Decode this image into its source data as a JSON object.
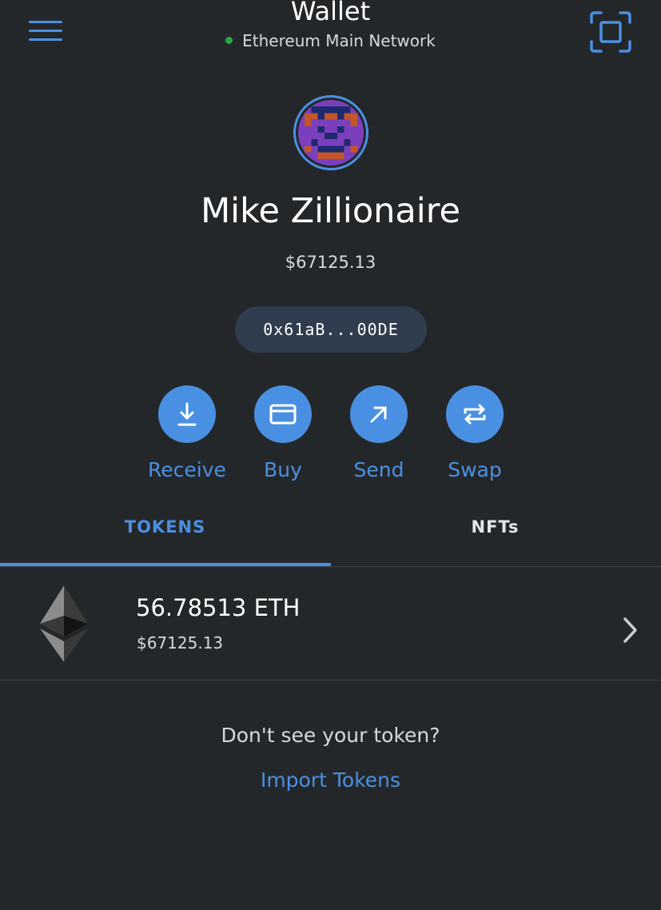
{
  "header": {
    "title": "Wallet",
    "network": "Ethereum Main Network",
    "menu_icon": "hamburger-menu-icon",
    "scan_icon": "qr-scan-icon"
  },
  "account": {
    "name": "Mike Zillionaire",
    "balance": "$67125.13",
    "address": "0x61aB...00DE"
  },
  "actions": [
    {
      "label": "Receive",
      "icon": "download-icon"
    },
    {
      "label": "Buy",
      "icon": "credit-card-icon"
    },
    {
      "label": "Send",
      "icon": "arrow-up-right-icon"
    },
    {
      "label": "Swap",
      "icon": "swap-arrows-icon"
    }
  ],
  "tabs": [
    {
      "label": "TOKENS",
      "active": true
    },
    {
      "label": "NFTs",
      "active": false
    }
  ],
  "tokens": [
    {
      "amount": "56.78513 ETH",
      "fiat": "$67125.13",
      "icon": "ethereum-icon"
    }
  ],
  "footer": {
    "prompt": "Don't see your token?",
    "link": "Import Tokens"
  },
  "colors": {
    "background": "#24272a",
    "accent": "#4a90e2",
    "network_dot": "#28a745",
    "address_pill": "#2f3d4f"
  }
}
